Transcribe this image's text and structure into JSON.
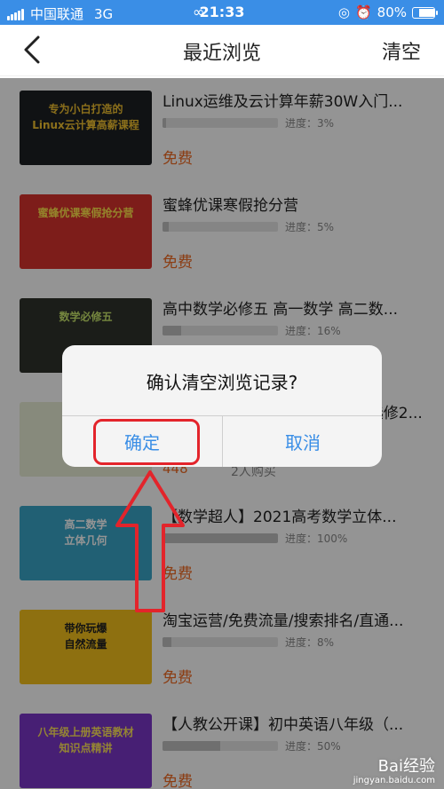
{
  "status_bar": {
    "carrier": "中国联通",
    "network": "3G",
    "time": "21:33",
    "battery": "80%",
    "battery_level": 0.8
  },
  "nav": {
    "title": "最近浏览",
    "clear_label": "清空"
  },
  "items": [
    {
      "title": "Linux运维及云计算年薪30W入门...",
      "progress_label": "进度：3%",
      "progress": 0.03,
      "price": "免费",
      "thumb": {
        "title": "专为小白打造的\nLinux云计算高薪课程",
        "bg": "#1d2024",
        "fg": "#f2c230"
      }
    },
    {
      "title": "蜜蜂优课寒假抢分营",
      "progress_label": "进度：5%",
      "progress": 0.05,
      "price": "免费",
      "thumb": {
        "title": "蜜蜂优课寒假抢分营",
        "bg": "#d8322d",
        "fg": "#ffe24a"
      }
    },
    {
      "title": "高中数学必修五 高一数学 高二数...",
      "progress_label": "进度：16%",
      "progress": 0.16,
      "price": "免费",
      "thumb": {
        "title": "数学必修五",
        "bg": "#2f332c",
        "fg": "#c8e66b"
      }
    },
    {
      "title": "高中数学必修五 高一数学 高二选修2...",
      "progress_label": "",
      "progress": 0,
      "price": "",
      "thumb": {
        "title": "",
        "bg": "#e8eed6",
        "fg": "#5a8a3a"
      }
    },
    {
      "title": "【数学超人】2021高考数学立体...",
      "progress_label": "进度：100%",
      "progress": 1.0,
      "price": "免费",
      "thumb": {
        "title": "高二数学\n立体几何",
        "bg": "#3aa6c8",
        "fg": "#ffffff"
      }
    },
    {
      "title": "淘宝运营/免费流量/搜索排名/直通...",
      "progress_label": "进度：8%",
      "progress": 0.08,
      "price": "免费",
      "thumb": {
        "title": "带你玩爆\n自然流量",
        "bg": "#f4c21c",
        "fg": "#222222"
      }
    },
    {
      "title": "【人教公开课】初中英语八年级（...",
      "progress_label": "进度：50%",
      "progress": 0.5,
      "price": "免费",
      "thumb": {
        "title": "八年级上册英语教材\n知识点精讲",
        "bg": "#7a36c8",
        "fg": "#ffe35a"
      }
    }
  ],
  "hidden_row": {
    "buyers": "448",
    "buyers_suffix": "2人购买"
  },
  "dialog": {
    "message": "确认清空浏览记录?",
    "ok_label": "确定",
    "cancel_label": "取消"
  },
  "watermark": {
    "brand": "Bai经验",
    "url": "jingyan.baidu.com"
  },
  "colors": {
    "accent": "#3a8ee6",
    "price": "#f06a22",
    "highlight": "#e3242b"
  }
}
